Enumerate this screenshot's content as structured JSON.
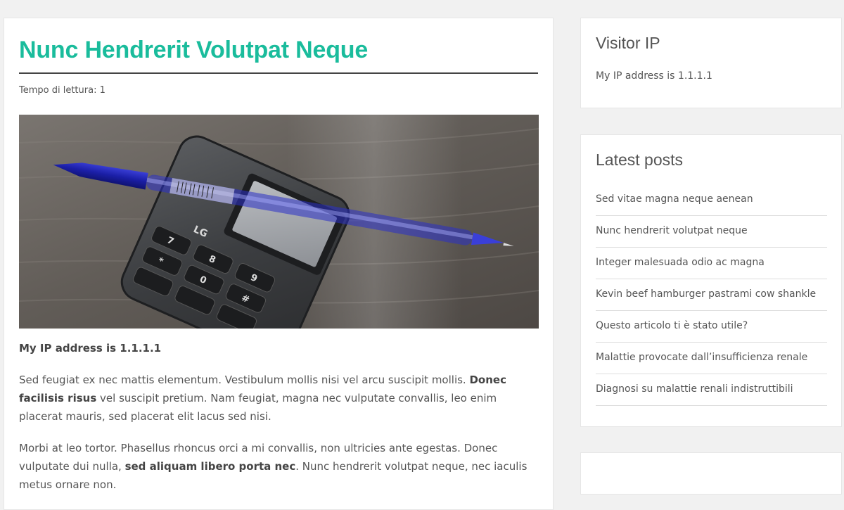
{
  "post": {
    "title": "Nunc Hendrerit Volutpat Neque",
    "reading_time": "Tempo di lettura: 1",
    "image_alt": "Phone and pen on a wooden desk",
    "ip_line": "My IP address is 1.1.1.1",
    "p1_a": "Sed feugiat ex nec mattis elementum. Vestibulum mollis nisi vel arcu suscipit mollis. ",
    "p1_bold": "Donec facilisis risus",
    "p1_b": " vel suscipit pretium. Nam feugiat, magna nec vulputate convallis, leo enim placerat mauris, sed placerat elit lacus sed nisi.",
    "p2_a": "Morbi at leo tortor. Phasellus rhoncus orci a mi convallis, non ultricies ante egestas. Donec vulputate dui nulla, ",
    "p2_bold": "sed aliquam libero porta nec",
    "p2_b": ". Nunc hendrerit volutpat neque, nec iaculis metus ornare non."
  },
  "sidebar": {
    "visitor_ip": {
      "title": "Visitor IP",
      "text": "My IP address is 1.1.1.1"
    },
    "latest_posts": {
      "title": "Latest posts",
      "items": [
        {
          "label": "Sed vitae magna neque aenean"
        },
        {
          "label": "Nunc hendrerit volutpat neque"
        },
        {
          "label": "Integer malesuada odio ac magna"
        },
        {
          "label": "Kevin beef hamburger pastrami cow shankle"
        },
        {
          "label": "Questo articolo ti è stato utile?"
        },
        {
          "label": "Malattie provocate dall’insufficienza renale"
        },
        {
          "label": "Diagnosi su malattie renali indistruttibili"
        }
      ]
    }
  },
  "colors": {
    "accent": "#1abc9c",
    "background": "#f1f1f1",
    "text": "#555555"
  }
}
